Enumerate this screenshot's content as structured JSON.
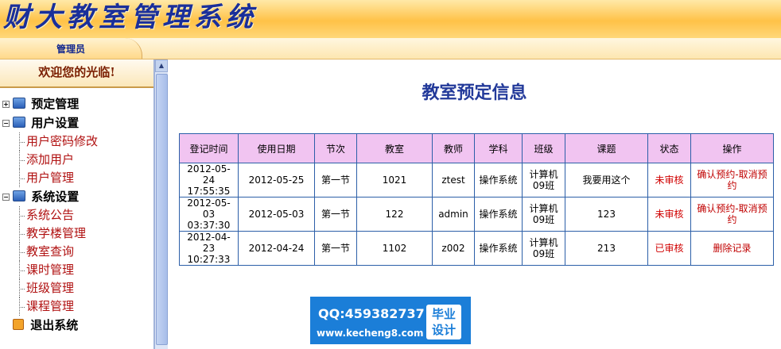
{
  "header": {
    "title": "财大教室管理系统"
  },
  "tab": {
    "role": "管理员"
  },
  "sidebar": {
    "welcome": "欢迎您的光临!",
    "groups": [
      {
        "label": "预定管理",
        "items": []
      },
      {
        "label": "用户设置",
        "items": [
          "用户密码修改",
          "添加用户",
          "用户管理"
        ]
      },
      {
        "label": "系统设置",
        "items": [
          "系统公告",
          "教学楼管理",
          "教室查询",
          "课时管理",
          "班级管理",
          "课程管理"
        ]
      }
    ],
    "exit": "退出系统"
  },
  "main": {
    "title": "教室预定信息",
    "columns": [
      "登记时间",
      "使用日期",
      "节次",
      "教室",
      "教师",
      "学科",
      "班级",
      "课题",
      "状态",
      "操作"
    ],
    "rows": [
      {
        "reg_date": "2012-05-24",
        "reg_time": "17:55:35",
        "use_date": "2012-05-25",
        "period": "第一节",
        "room": "1021",
        "teacher": "ztest",
        "subject": "操作系统",
        "class_a": "计算机",
        "class_b": "09班",
        "topic": "我要用这个",
        "status": "未审核",
        "action_confirm": "确认预约",
        "action_sep": "-",
        "action_cancel": "取消预约"
      },
      {
        "reg_date": "2012-05-03",
        "reg_time": "03:37:30",
        "use_date": "2012-05-03",
        "period": "第一节",
        "room": "122",
        "teacher": "admin",
        "subject": "操作系统",
        "class_a": "计算机",
        "class_b": "09班",
        "topic": "123",
        "status": "未审核",
        "action_confirm": "确认预约",
        "action_sep": "-",
        "action_cancel": "取消预约"
      },
      {
        "reg_date": "2012-04-23",
        "reg_time": "10:27:33",
        "use_date": "2012-04-24",
        "period": "第一节",
        "room": "1102",
        "teacher": "z002",
        "subject": "操作系统",
        "class_a": "计算机",
        "class_b": "09班",
        "topic": "213",
        "status": "已审核",
        "action_delete": "删除记录"
      }
    ]
  },
  "watermark": {
    "qq": "QQ:459382737",
    "site": "www.kecheng8.com",
    "badge_line1": "毕业",
    "badge_line2": "设计"
  }
}
